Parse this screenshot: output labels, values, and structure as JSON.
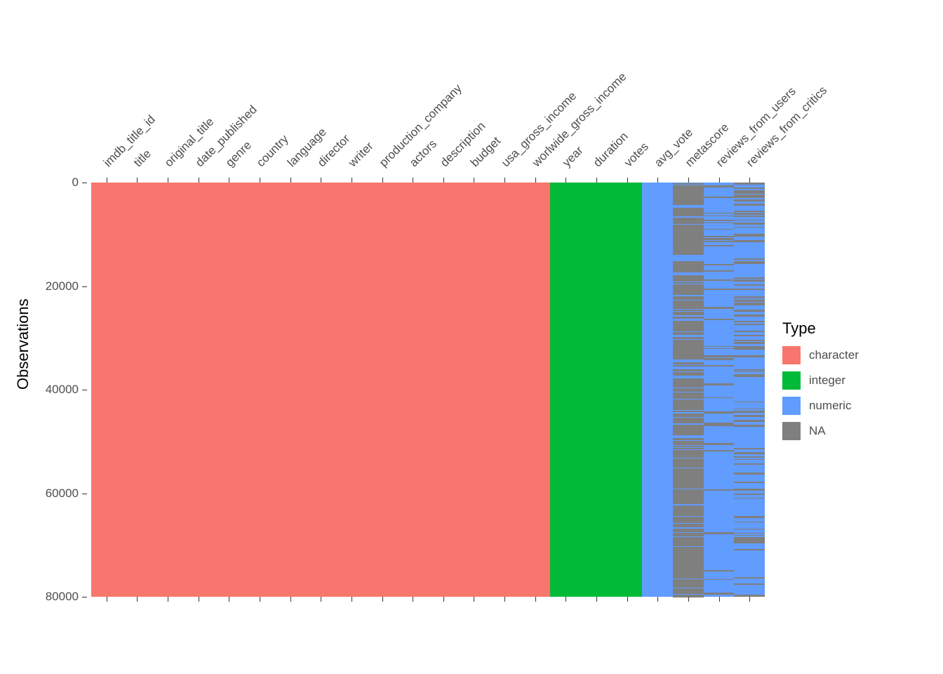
{
  "chart_data": {
    "type": "heatmap",
    "ylabel": "Observations",
    "ylim": [
      0,
      80000
    ],
    "y_ticks": [
      0,
      20000,
      40000,
      60000,
      80000
    ],
    "legend_title": "Type",
    "legend_items": [
      {
        "label": "character",
        "color": "#F8766D"
      },
      {
        "label": "integer",
        "color": "#00BA38"
      },
      {
        "label": "numeric",
        "color": "#619CFF"
      },
      {
        "label": "NA",
        "color": "#7f7f7f"
      }
    ],
    "n_obs": 80000,
    "columns": [
      {
        "name": "imdb_title_id",
        "type": "character",
        "na_fraction": 0.0
      },
      {
        "name": "title",
        "type": "character",
        "na_fraction": 0.0
      },
      {
        "name": "original_title",
        "type": "character",
        "na_fraction": 0.0
      },
      {
        "name": "date_published",
        "type": "character",
        "na_fraction": 0.0
      },
      {
        "name": "genre",
        "type": "character",
        "na_fraction": 0.0
      },
      {
        "name": "country",
        "type": "character",
        "na_fraction": 0.0
      },
      {
        "name": "language",
        "type": "character",
        "na_fraction": 0.0
      },
      {
        "name": "director",
        "type": "character",
        "na_fraction": 0.0
      },
      {
        "name": "writer",
        "type": "character",
        "na_fraction": 0.0
      },
      {
        "name": "production_company",
        "type": "character",
        "na_fraction": 0.0
      },
      {
        "name": "actors",
        "type": "character",
        "na_fraction": 0.0
      },
      {
        "name": "description",
        "type": "character",
        "na_fraction": 0.0
      },
      {
        "name": "budget",
        "type": "character",
        "na_fraction": 0.0
      },
      {
        "name": "usa_gross_income",
        "type": "character",
        "na_fraction": 0.0
      },
      {
        "name": "worlwide_gross_income",
        "type": "character",
        "na_fraction": 0.0
      },
      {
        "name": "year",
        "type": "integer",
        "na_fraction": 0.0
      },
      {
        "name": "duration",
        "type": "integer",
        "na_fraction": 0.0
      },
      {
        "name": "votes",
        "type": "integer",
        "na_fraction": 0.0
      },
      {
        "name": "avg_vote",
        "type": "numeric",
        "na_fraction": 0.0
      },
      {
        "name": "metascore",
        "type": "numeric",
        "na_fraction": 0.85,
        "na_pattern": "dense"
      },
      {
        "name": "reviews_from_users",
        "type": "numeric",
        "na_fraction": 0.15,
        "na_pattern": "sparse-upper"
      },
      {
        "name": "reviews_from_critics",
        "type": "numeric",
        "na_fraction": 0.35,
        "na_pattern": "sparse-graded"
      }
    ]
  }
}
